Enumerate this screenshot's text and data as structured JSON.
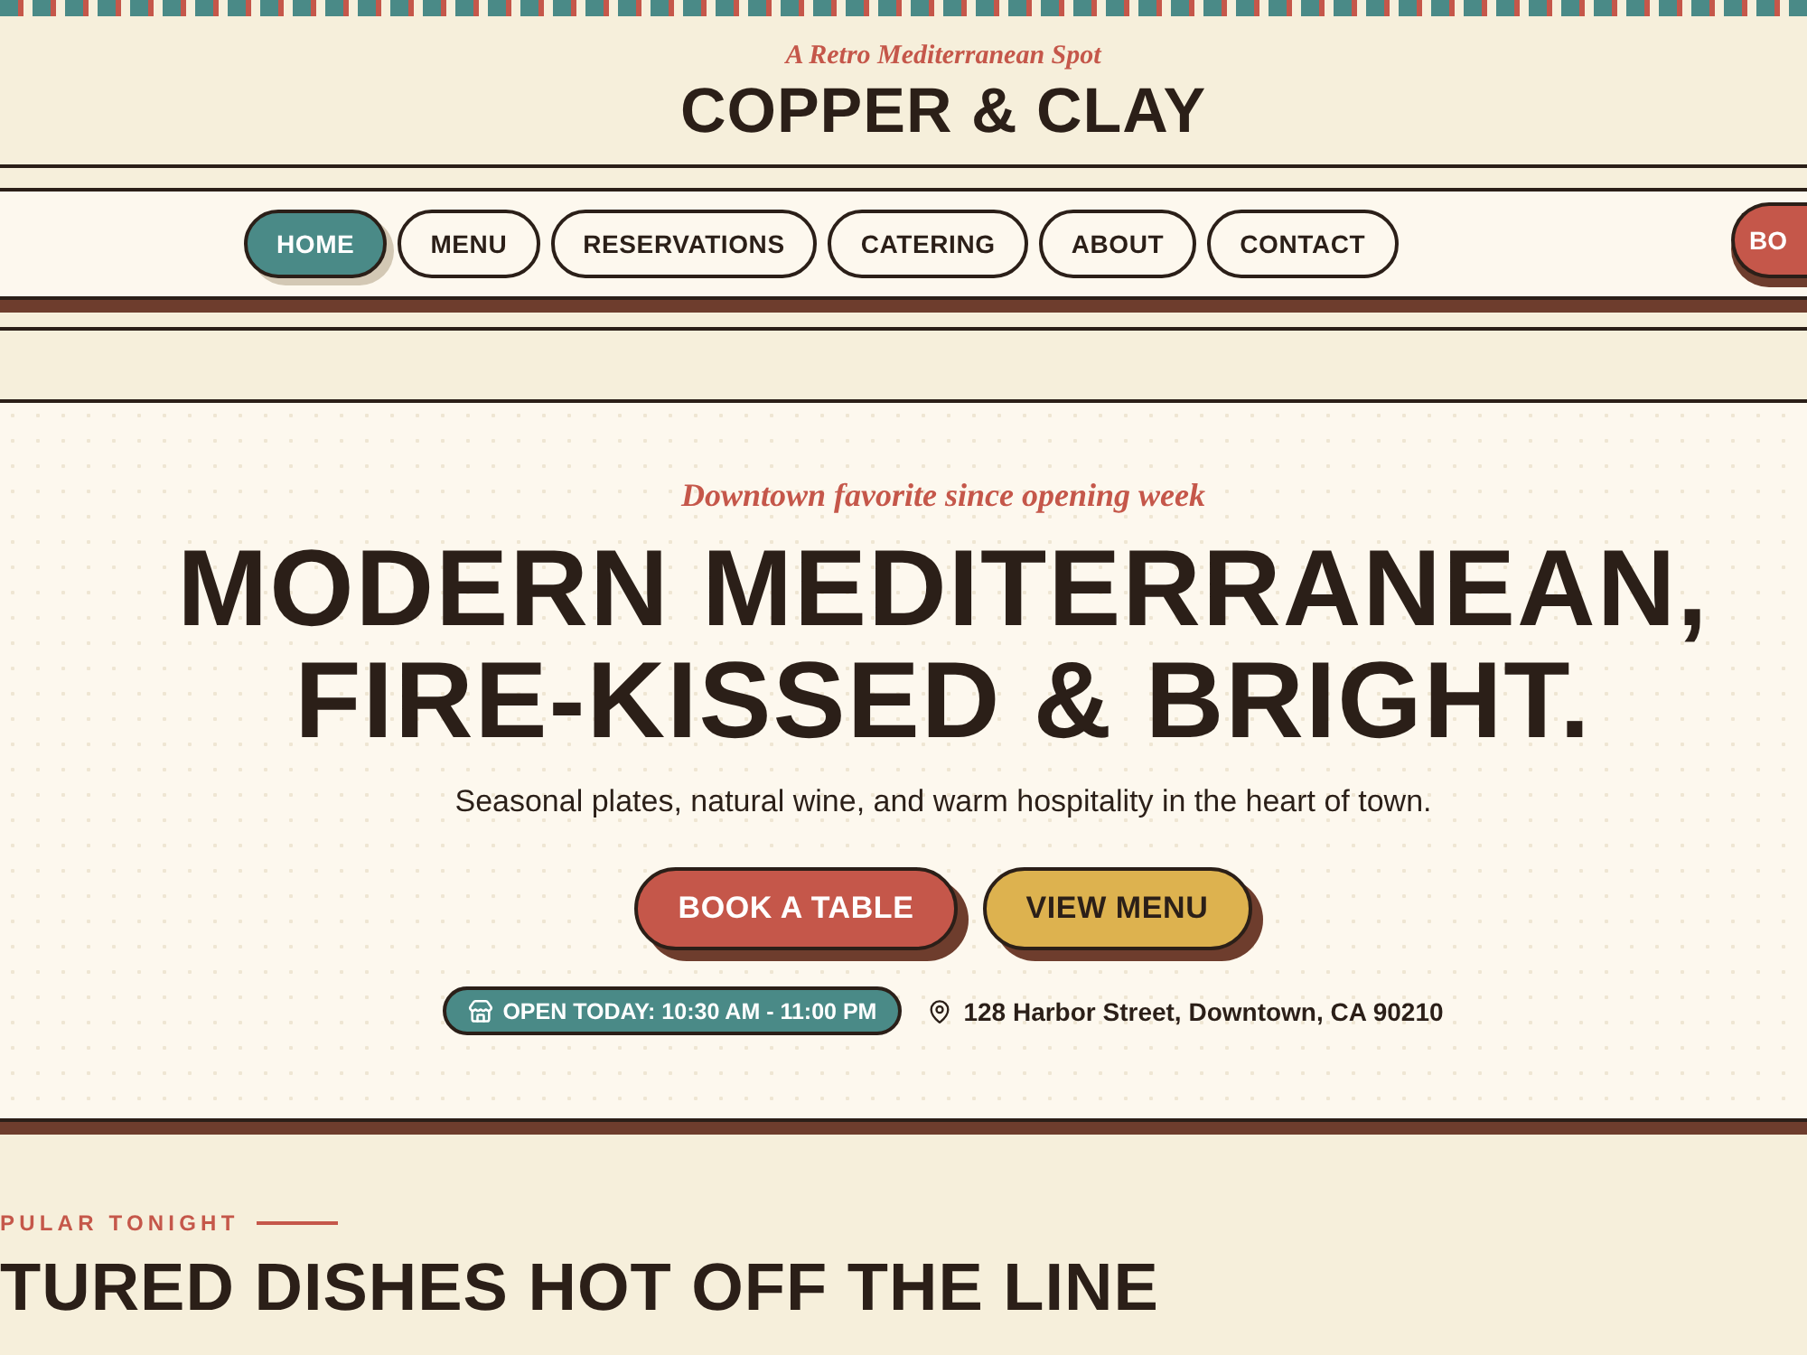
{
  "header": {
    "tagline": "A Retro Mediterranean Spot",
    "brand": "COPPER & CLAY"
  },
  "nav": {
    "items": [
      {
        "label": "HOME",
        "selected": true
      },
      {
        "label": "MENU",
        "selected": false
      },
      {
        "label": "RESERVATIONS",
        "selected": false
      },
      {
        "label": "CATERING",
        "selected": false
      },
      {
        "label": "ABOUT",
        "selected": false
      },
      {
        "label": "CONTACT",
        "selected": false
      }
    ],
    "cta": "BO"
  },
  "hero": {
    "kicker": "Downtown favorite since opening week",
    "headline": [
      "MODERN MEDITERRANEAN,",
      "FIRE-KISSED & BRIGHT."
    ],
    "subtitle": "Seasonal plates, natural wine, and warm hospitality in the heart of town.",
    "buttons": [
      {
        "label": "BOOK A TABLE",
        "kind": "primary"
      },
      {
        "label": "VIEW MENU",
        "kind": "secondary"
      }
    ],
    "hours": "OPEN TODAY: 10:30 AM - 11:00 PM",
    "address": "128 Harbor Street, Downtown, CA 90210"
  },
  "featured": {
    "eyebrow": "PULAR TONIGHT",
    "title": "TURED DISHES HOT OFF THE LINE"
  }
}
